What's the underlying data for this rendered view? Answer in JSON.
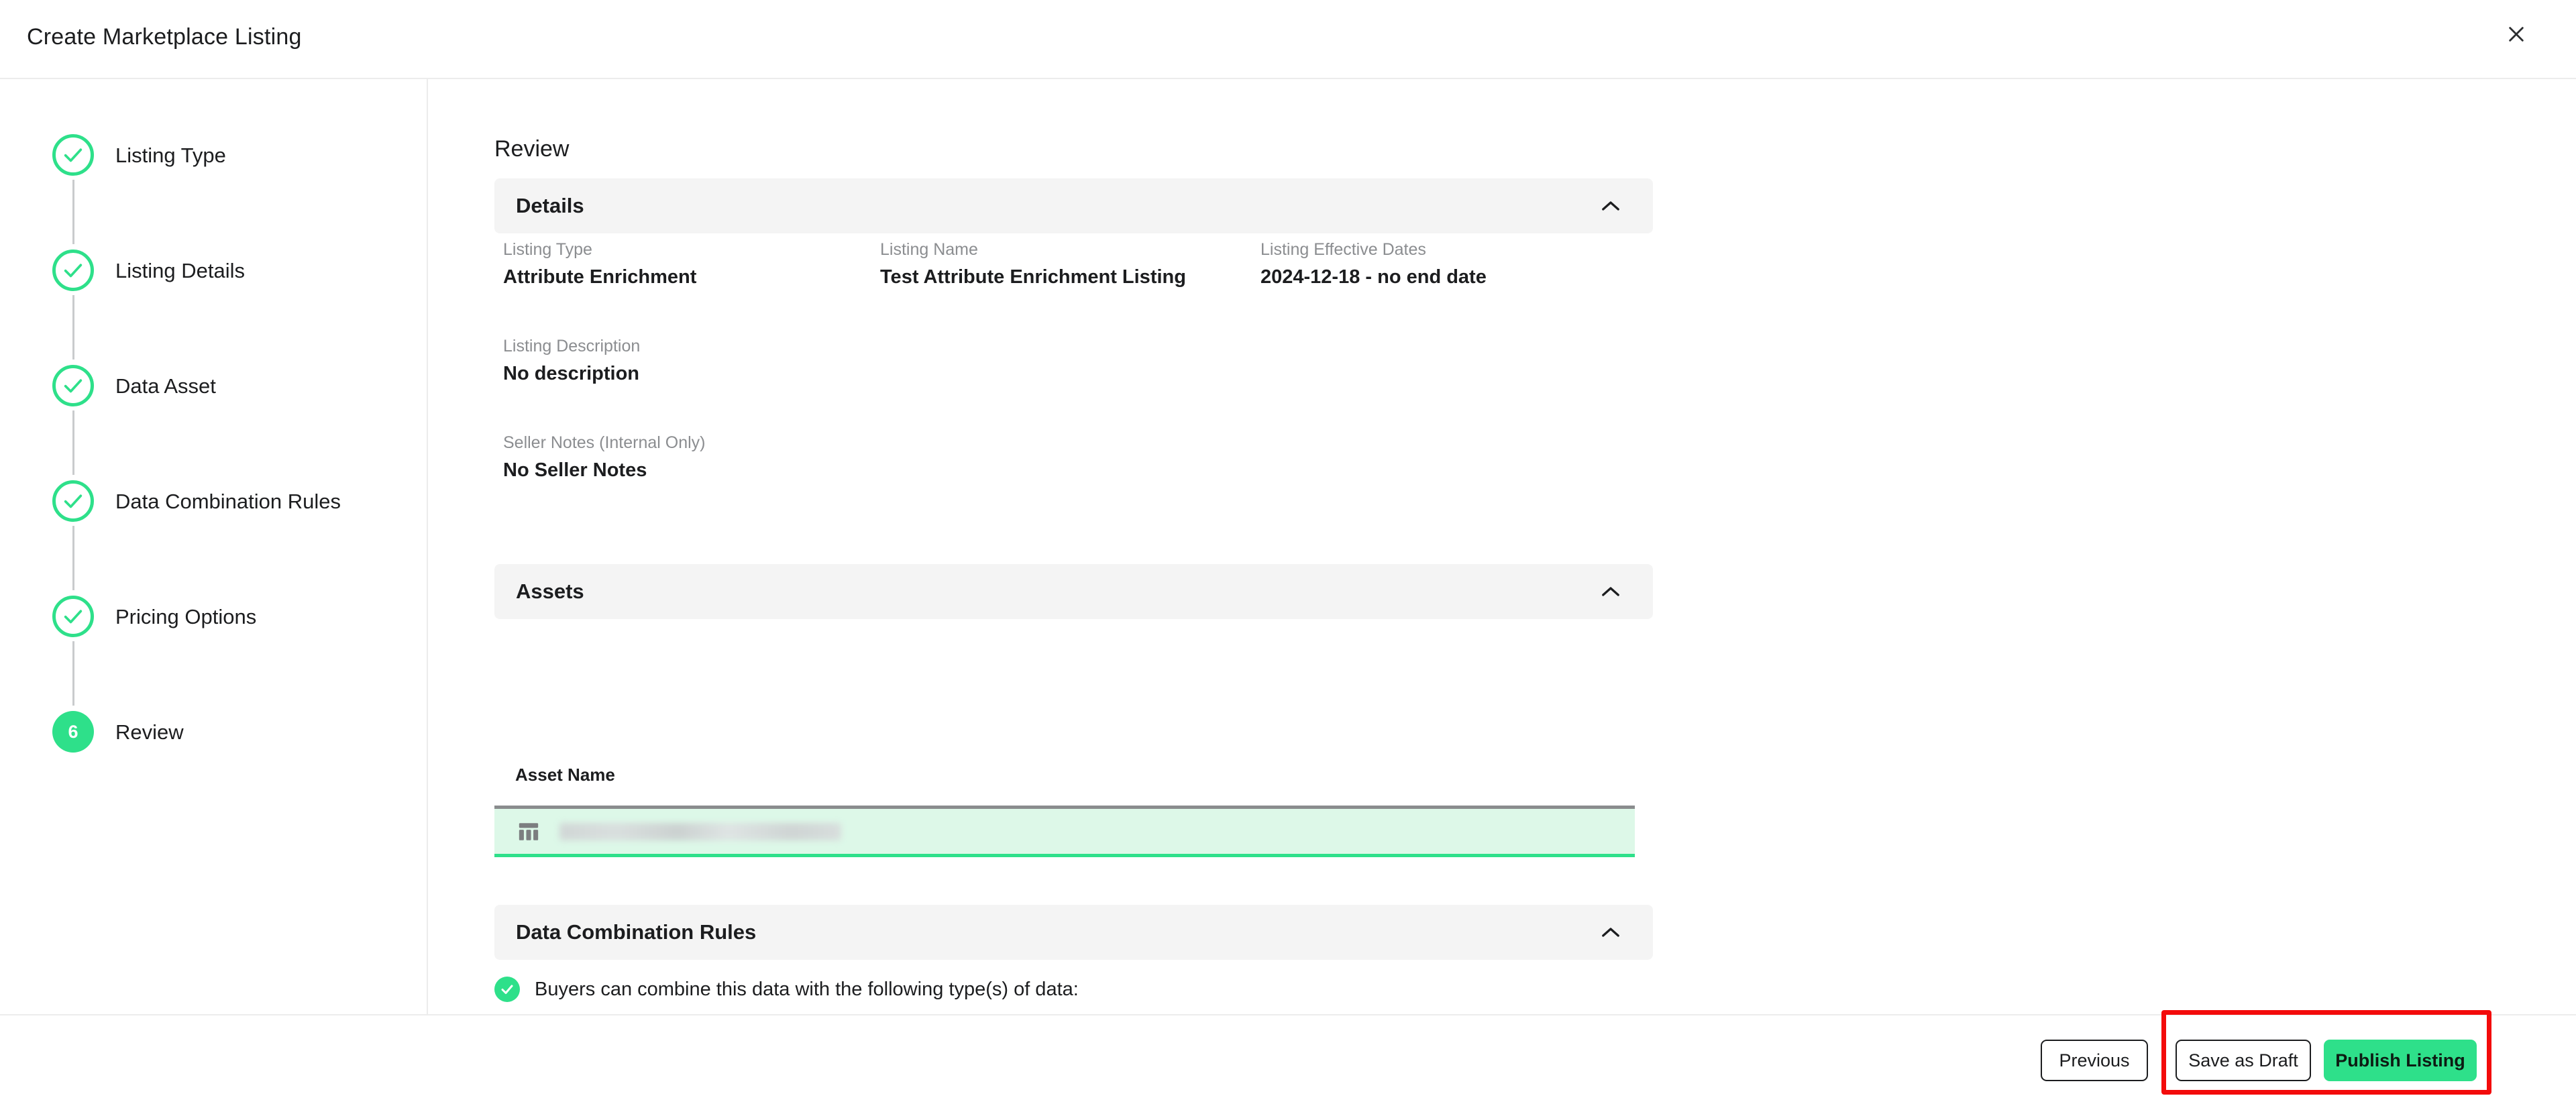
{
  "window": {
    "title": "Create Marketplace Listing",
    "close_icon": "close-icon"
  },
  "colors": {
    "accent_green": "#2ee08a",
    "panel_grey": "#f4f4f4",
    "highlight_red": "#f30b0b",
    "asset_row_bg": "#ddf8e8"
  },
  "sidebar": {
    "steps": [
      {
        "label": "Listing Type",
        "state": "done",
        "number": "1"
      },
      {
        "label": "Listing Details",
        "state": "done",
        "number": "2"
      },
      {
        "label": "Data Asset",
        "state": "done",
        "number": "3"
      },
      {
        "label": "Data Combination Rules",
        "state": "done",
        "number": "4"
      },
      {
        "label": "Pricing Options",
        "state": "done",
        "number": "5"
      },
      {
        "label": "Review",
        "state": "active",
        "number": "6"
      }
    ]
  },
  "main": {
    "heading": "Review",
    "sections": {
      "details": {
        "title": "Details",
        "collapse_icon": "chevron-up-icon",
        "fields": [
          {
            "label": "Listing Type",
            "value": "Attribute Enrichment"
          },
          {
            "label": "Listing Name",
            "value": "Test Attribute Enrichment Listing"
          },
          {
            "label": "Listing Effective Dates",
            "value": "2024-12-18 - no end date"
          },
          {
            "label": "Listing Description",
            "value": "No description"
          },
          {
            "label": "Seller Notes (Internal Only)",
            "value": "No Seller Notes"
          }
        ]
      },
      "assets": {
        "title": "Assets",
        "collapse_icon": "chevron-up-icon",
        "column_header": "Asset Name",
        "rows": [
          {
            "name": "",
            "redacted": true,
            "icon": "table-icon",
            "selected": true
          }
        ]
      },
      "data_combination_rules": {
        "title": "Data Combination Rules",
        "collapse_icon": "chevron-up-icon",
        "rule_text": "Buyers can combine this data with the following type(s) of data:",
        "rule_icon": "check-circle-icon",
        "rows": [
          {
            "name": "",
            "redacted": true,
            "icon": "shield-icon"
          }
        ]
      }
    }
  },
  "footer": {
    "previous_label": "Previous",
    "save_draft_label": "Save as Draft",
    "publish_label": "Publish Listing"
  }
}
